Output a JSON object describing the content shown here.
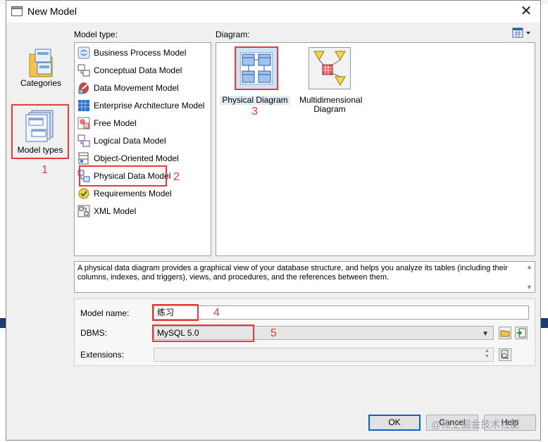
{
  "window": {
    "title": "New Model",
    "close_symbol": "✕"
  },
  "left_pane": {
    "items": [
      {
        "label": "Categories",
        "icon": "categories-icon"
      },
      {
        "label": "Model types",
        "icon": "model-types-icon",
        "selected": true
      }
    ]
  },
  "model_type": {
    "label": "Model type:",
    "items": [
      {
        "label": "Business Process Model",
        "icon": "business-process-model-icon"
      },
      {
        "label": "Conceptual Data Model",
        "icon": "conceptual-data-model-icon"
      },
      {
        "label": "Data Movement Model",
        "icon": "data-movement-model-icon"
      },
      {
        "label": "Enterprise Architecture Model",
        "icon": "enterprise-architecture-model-icon"
      },
      {
        "label": "Free Model",
        "icon": "free-model-icon"
      },
      {
        "label": "Logical Data Model",
        "icon": "logical-data-model-icon"
      },
      {
        "label": "Object-Oriented Model",
        "icon": "object-oriented-model-icon"
      },
      {
        "label": "Physical Data Model",
        "icon": "physical-data-model-icon",
        "selected": true
      },
      {
        "label": "Requirements Model",
        "icon": "requirements-model-icon"
      },
      {
        "label": "XML Model",
        "icon": "xml-model-icon"
      }
    ]
  },
  "diagram": {
    "label": "Diagram:",
    "view_icon": "view-options-icon",
    "items": [
      {
        "label": "Physical Diagram",
        "icon": "physical-diagram-icon",
        "selected": true
      },
      {
        "label": "Multidimensional Diagram",
        "line1": "Multidimensional",
        "line2": "Diagram",
        "icon": "multidimensional-diagram-icon"
      }
    ]
  },
  "description": "A physical data diagram provides a graphical view of your database structure, and helps you analyze its tables (including their columns, indexes, and triggers), views, and procedures, and the references between them.",
  "form": {
    "model_name_label": "Model name:",
    "model_name_value": "练习",
    "dbms_label": "DBMS:",
    "dbms_value": "MySQL 5.0",
    "extensions_label": "Extensions:",
    "extensions_value": ""
  },
  "buttons": {
    "ok": "OK",
    "cancel": "Cancel",
    "help": "Help"
  },
  "annotations": {
    "n1": "1",
    "n2": "2",
    "n3": "3",
    "n4": "4",
    "n5": "5"
  },
  "watermark": "@稀土掘金技术社区",
  "colors": {
    "annotation_red": "#e53b3b",
    "selection_blue": "#0a64c8"
  }
}
